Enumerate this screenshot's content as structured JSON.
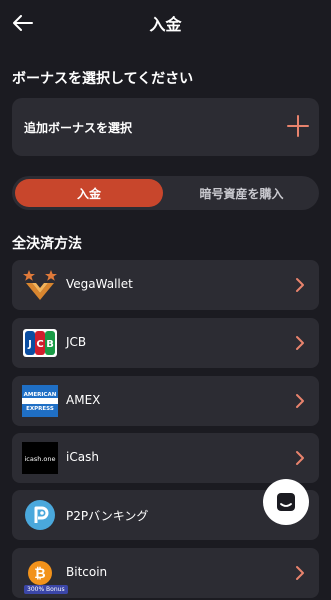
{
  "header": {
    "title": "入金",
    "back_icon": "arrow-left-icon"
  },
  "bonus_section": {
    "title": "ボーナスを選択してください",
    "select_label": "追加ボーナスを選択",
    "add_icon": "plus-icon"
  },
  "tabs": {
    "deposit": "入金",
    "buy_crypto": "暗号資産を購入",
    "active": "deposit"
  },
  "methods_title": "全決済方法",
  "methods": [
    {
      "label": "VegaWallet",
      "icon": "vegawallet-logo-icon"
    },
    {
      "label": "JCB",
      "icon": "jcb-logo-icon"
    },
    {
      "label": "AMEX",
      "icon": "amex-logo-icon"
    },
    {
      "label": "iCash",
      "icon": "icash-logo-icon"
    },
    {
      "label": "P2Pバンキング",
      "icon": "p2p-logo-icon"
    },
    {
      "label": "Bitcoin",
      "icon": "bitcoin-logo-icon"
    }
  ],
  "logo_text": {
    "amex": "AMERICAN EXPRESS",
    "icash": "icash.one"
  },
  "bitcoin_bonus_tag": "300% Bonus",
  "colors": {
    "background": "#1b1b21",
    "card": "#2c2c33",
    "accent": "#c8462c",
    "chevron": "#e8836d"
  }
}
